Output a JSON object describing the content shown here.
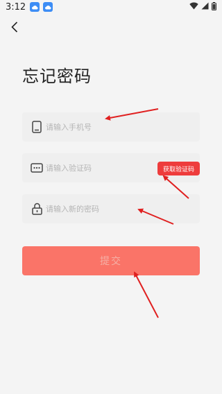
{
  "status_bar": {
    "time": "3:12",
    "icons": [
      "cloud-notification-icon",
      "cloud-notification-icon",
      "wifi-icon",
      "signal-icon",
      "battery-icon"
    ]
  },
  "header": {
    "back_icon": "chevron-left-icon"
  },
  "page": {
    "title": "忘记密码"
  },
  "form": {
    "phone": {
      "icon": "phone-icon",
      "value": "",
      "placeholder": "请输入手机号"
    },
    "code": {
      "icon": "more-dots-icon",
      "value": "",
      "placeholder": "请输入验证码",
      "get_code_label": "获取验证码"
    },
    "password": {
      "icon": "lock-icon",
      "value": "",
      "placeholder": "请输入新的密码"
    },
    "submit_label": "提交"
  },
  "colors": {
    "accent_red": "#ee3c3c",
    "submit_bg": "#fa7468",
    "annotation_arrow": "#e02020",
    "background": "#f4f4f4",
    "field_bg": "#efefef"
  }
}
